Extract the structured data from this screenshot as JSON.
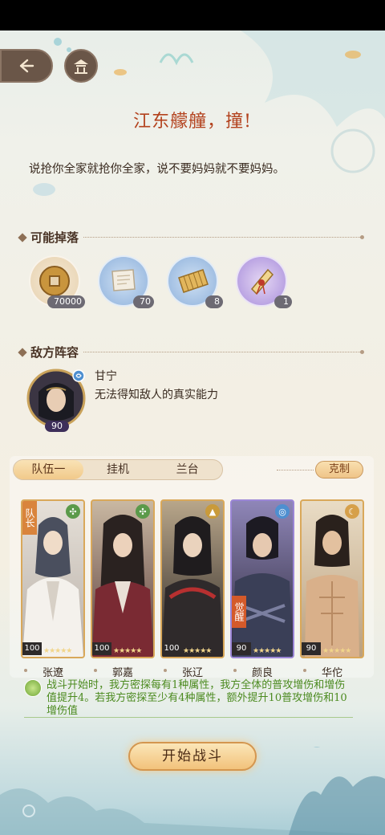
{
  "stage": {
    "title": "江东艨艟，撞!",
    "description": "说抢你全家就抢你全家，说不要妈妈就不要妈妈。"
  },
  "drops": {
    "section_label": "可能掉落",
    "items": [
      {
        "icon": "copper-coin-icon",
        "count": "70000"
      },
      {
        "icon": "scroll-icon",
        "count": "70"
      },
      {
        "icon": "bamboo-slip-icon",
        "count": "8"
      },
      {
        "icon": "sealed-scroll-icon",
        "count": "1"
      }
    ]
  },
  "enemy": {
    "section_label": "敌方阵容",
    "name": "甘宁",
    "description": "无法得知敌人的真实能力",
    "level": "90"
  },
  "team": {
    "tabs": [
      "队伍一",
      "挂机",
      "兰台"
    ],
    "active_tab": "队伍一",
    "counter_label": "克制",
    "captain_label": "队长",
    "awaken_label": "觉醒",
    "members": [
      {
        "name": "张遼",
        "level": "100",
        "stars": "★★★★★"
      },
      {
        "name": "郭嘉",
        "level": "100",
        "stars": "★★★★★"
      },
      {
        "name": "张辽",
        "level": "100",
        "stars": "★★★★★"
      },
      {
        "name": "颜良",
        "level": "90",
        "stars": "★★★★★"
      },
      {
        "name": "华佗",
        "level": "90",
        "stars": "★★★★★"
      }
    ]
  },
  "buff": {
    "text": "战斗开始时，我方密探每有1种属性，我方全体的普攻增伤和增伤值提升4。若我方密探至少有4种属性，额外提升10普攻增伤和10增伤值"
  },
  "start_button": "开始战斗",
  "colors": {
    "title": "#b3421e",
    "buff_text": "#4b8a1f",
    "gold_border": "#d9a85a",
    "purple_border": "#9b86d6"
  }
}
